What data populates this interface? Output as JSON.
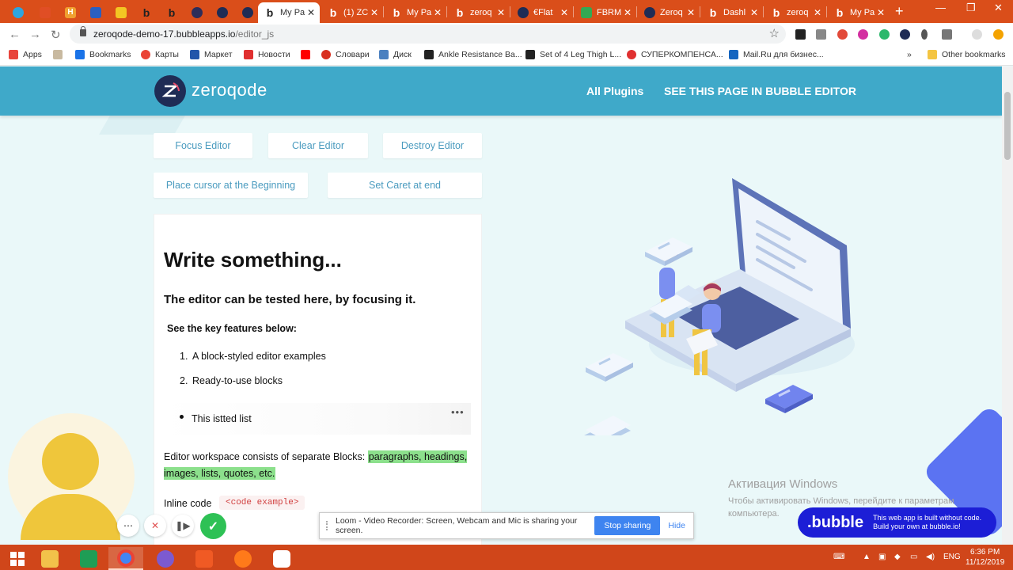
{
  "browser": {
    "tabs": [
      {
        "label": "",
        "icon": "telegram-icon",
        "color": "#2ca5e0"
      },
      {
        "label": "",
        "icon": "asterisk-icon",
        "color": "#e04e25"
      },
      {
        "label": "",
        "icon": "h-icon",
        "color": "#f0a030"
      },
      {
        "label": "",
        "icon": "book-icon",
        "color": "#2a5fc0"
      },
      {
        "label": "",
        "icon": "flag-icon",
        "color": "#f3c623"
      },
      {
        "label": "",
        "icon": "bubble-b-icon",
        "color": "#3a3a3a"
      },
      {
        "label": "",
        "icon": "bubble-b-icon",
        "color": "#3a3a3a"
      },
      {
        "label": "",
        "icon": "hexagon-icon",
        "color": "#2d2d5a"
      },
      {
        "label": "",
        "icon": "zeroqode-icon",
        "color": "#1f2c55"
      },
      {
        "label": "",
        "icon": "zeroqode-icon",
        "color": "#1f2c55"
      },
      {
        "label": "My Pa",
        "icon": "bubble-b-icon",
        "color": "#3a3a3a",
        "active": true
      },
      {
        "label": "(1) ZC",
        "icon": "bubble-b-icon",
        "color": "#3a3a3a"
      },
      {
        "label": "My Pa",
        "icon": "bubble-b-icon",
        "color": "#3a3a3a"
      },
      {
        "label": "zeroq",
        "icon": "bubble-b-icon",
        "color": "#3a3a3a"
      },
      {
        "label": "€Flat",
        "icon": "zeroqode-icon",
        "color": "#1f2c55"
      },
      {
        "label": "FBRM",
        "icon": "drive-icon",
        "color": "#34a853"
      },
      {
        "label": "Zeroq",
        "icon": "zeroqode-icon",
        "color": "#1f2c55"
      },
      {
        "label": "Dashl",
        "icon": "bubble-b-icon",
        "color": "#3a3a3a"
      },
      {
        "label": "zeroq",
        "icon": "bubble-b-icon",
        "color": "#3a3a3a"
      },
      {
        "label": "My Pa",
        "icon": "bubble-b-icon",
        "color": "#3a3a3a"
      }
    ],
    "url_host": "zeroqode-demo-17.bubbleapps.io",
    "url_path": "/editor_js",
    "new_tab": "+",
    "bookmarks": [
      {
        "label": "Apps",
        "icon": "apps-icon",
        "color": "#e8453c"
      },
      {
        "label": "",
        "icon": "image-icon",
        "color": "#c8b9a0"
      },
      {
        "label": "Bookmarks",
        "icon": "star-icon",
        "color": "#1a73e8"
      },
      {
        "label": "Карты",
        "icon": "maps-pin-icon",
        "color": "#ea4335"
      },
      {
        "label": "Маркет",
        "icon": "cart-icon",
        "color": "#2255aa"
      },
      {
        "label": "Новости",
        "icon": "news-icon",
        "color": "#e03030"
      },
      {
        "label": "",
        "icon": "youtube-icon",
        "color": "#ff0000"
      },
      {
        "label": "Словари",
        "icon": "dictionary-icon",
        "color": "#d83020"
      },
      {
        "label": "Диск",
        "icon": "disk-icon",
        "color": "#4a80c0"
      },
      {
        "label": "Ankle Resistance Ba...",
        "icon": "amazon-icon",
        "color": "#222222"
      },
      {
        "label": "Set of 4 Leg Thigh L...",
        "icon": "amazon-icon",
        "color": "#222222"
      },
      {
        "label": "СУПЕРКОМПЕНСА...",
        "icon": "heart-icon",
        "color": "#e03030"
      },
      {
        "label": "Mail.Ru для бизнес...",
        "icon": "mail-icon",
        "color": "#1565c0"
      },
      {
        "label": "»",
        "icon": "",
        "color": ""
      },
      {
        "label": "Other bookmarks",
        "icon": "folder-icon",
        "color": "#f4c542"
      }
    ]
  },
  "header": {
    "logo_text": "zeroqode",
    "nav": [
      "All Plugins",
      "SEE THIS PAGE IN BUBBLE EDITOR"
    ]
  },
  "buttons": {
    "focus": "Focus Editor",
    "clear": "Clear Editor",
    "destroy": "Destroy Editor",
    "place_cursor": "Place cursor at the Beginning",
    "set_caret": "Set Caret at end"
  },
  "editor": {
    "h1": "Write something...",
    "h2": "The editor can be tested here, by focusing it.",
    "h3": "See the key features below:",
    "list": [
      {
        "num": "1.",
        "text": "A block-styled editor examples"
      },
      {
        "num": "2.",
        "text": "Ready-to-use blocks"
      }
    ],
    "bullet": "This istted list",
    "para_prefix": "Editor workspace consists of separate Blocks: ",
    "para_highlight": "paragraphs, headings, images, lists, quotes, etc.",
    "inline_label": "Inline code",
    "code_example": "<code example>"
  },
  "windows_activation": {
    "title": "Активация Windows",
    "subtitle": "Чтобы активировать Windows, перейдите к параметрам компьютера."
  },
  "bubble_badge": {
    "name": ".bubble",
    "line1": "This web app is built without code.",
    "line2": "Build your own at bubble.io!"
  },
  "loom": {
    "share_text": "Loom - Video Recorder: Screen, Webcam and Mic is sharing your screen.",
    "stop_label": "Stop sharing",
    "hide_label": "Hide"
  },
  "taskbar": {
    "lang": "ENG",
    "time": "6:36 PM",
    "date": "11/12/2019"
  },
  "colors": {
    "header_bg": "#3fa9c9",
    "accent_link": "#4a9bbf",
    "highlight": "#8ce08c",
    "taskbar": "#d0461a"
  }
}
